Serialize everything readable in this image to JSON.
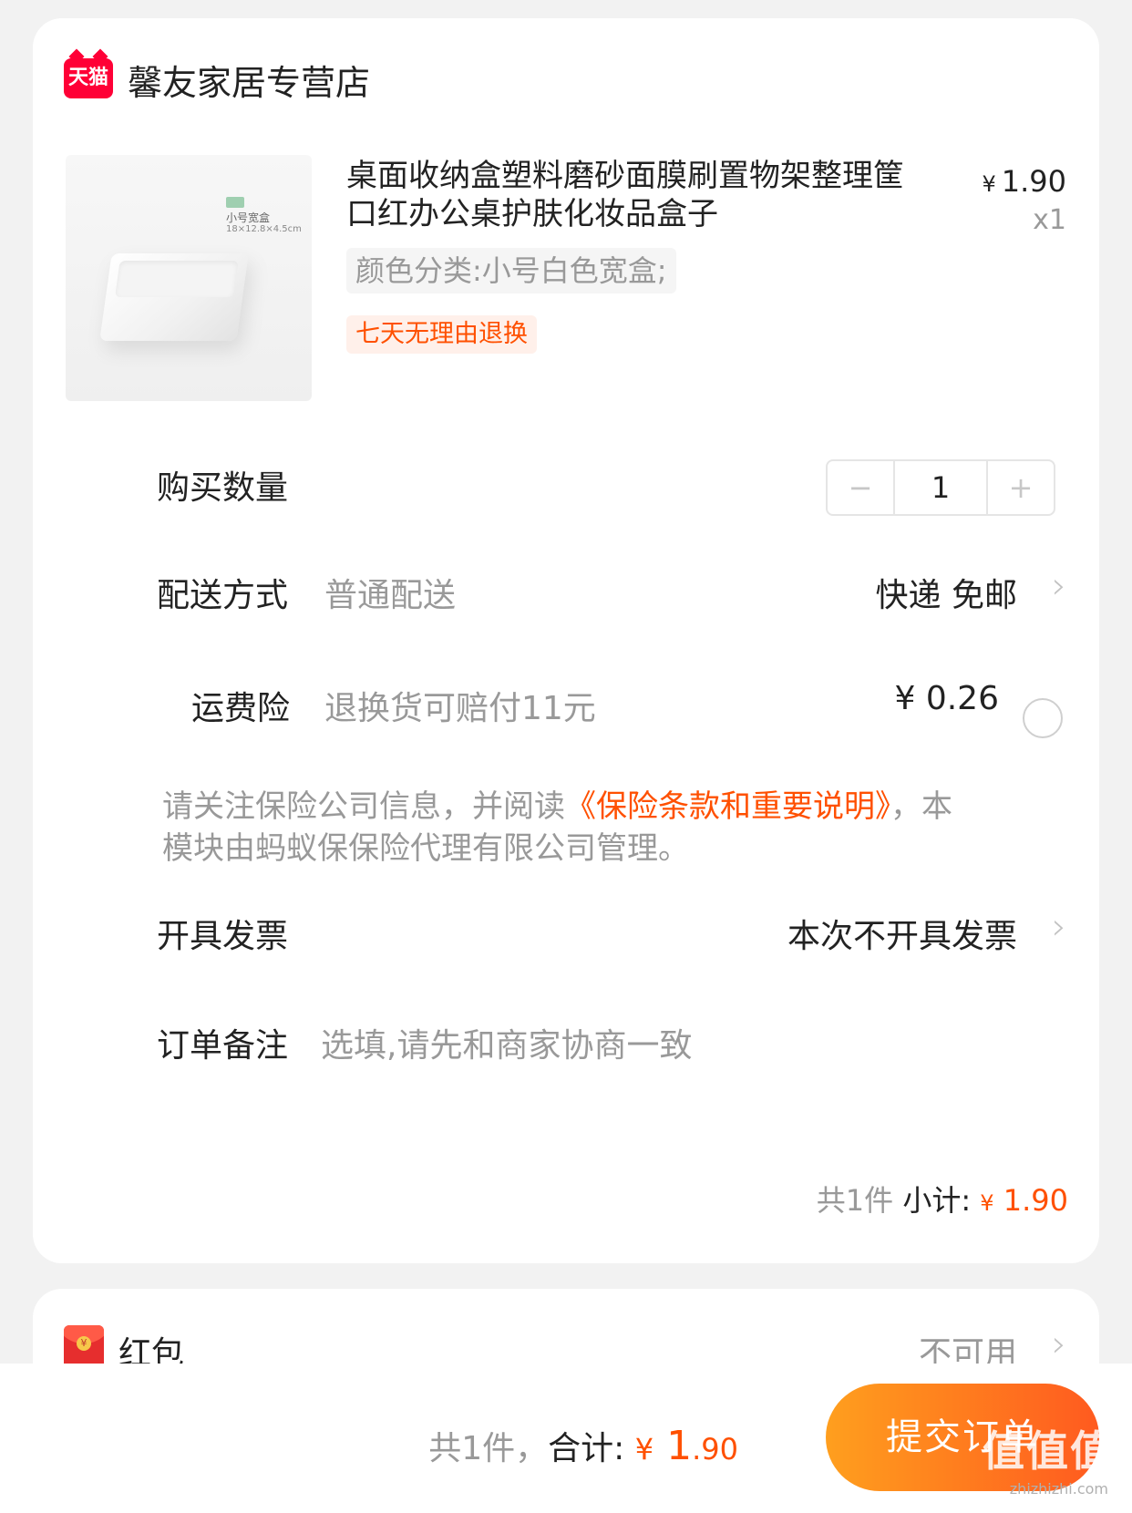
{
  "shop": {
    "logo_text": "天猫",
    "name": "馨友家居专营店"
  },
  "product": {
    "image_label": "小号宽盒",
    "image_dims": "18×12.8×4.5cm",
    "title": "桌面收纳盒塑料磨砂面膜刷置物架整理筐口红办公桌护肤化妆品盒子",
    "currency": "¥",
    "price": "1.90",
    "quantity_text": "x1",
    "sku": "颜色分类:小号白色宽盒;",
    "badge": "七天无理由退换"
  },
  "quantity": {
    "label": "购买数量",
    "minus": "−",
    "value": "1",
    "plus": "+"
  },
  "delivery": {
    "label": "配送方式",
    "method": "普通配送",
    "value": "快递 免邮"
  },
  "insurance": {
    "label": "运费险",
    "description": "退换货可赔付11元",
    "price": "¥ 0.26",
    "notice_before": "请关注保险公司信息，并阅读",
    "notice_link": "《保险条款和重要说明》",
    "notice_after": "，本模块由蚂蚁保保险代理有限公司管理。"
  },
  "invoice": {
    "label": "开具发票",
    "value": "本次不开具发票"
  },
  "remark": {
    "label": "订单备注",
    "placeholder": "选填,请先和商家协商一致"
  },
  "subtotal": {
    "count": "共1件",
    "label": "小计:",
    "currency": "¥",
    "price": "1.90"
  },
  "red_packet": {
    "label": "红包",
    "value": "不可用"
  },
  "bottom": {
    "count": "共1件，",
    "total_label": "合计:",
    "currency": "¥",
    "price_int": "1",
    "price_dec": ".90",
    "submit": "提交订单"
  },
  "watermark": {
    "main": "值值值",
    "sub": "zhizhizhi.com"
  },
  "colors": {
    "accent": "#ff5000",
    "tmall": "#ff0036",
    "background": "#f2f2f2"
  },
  "icons": [
    "tmall-logo",
    "chevron-right-icon",
    "radio-unchecked-icon",
    "red-packet-icon"
  ]
}
